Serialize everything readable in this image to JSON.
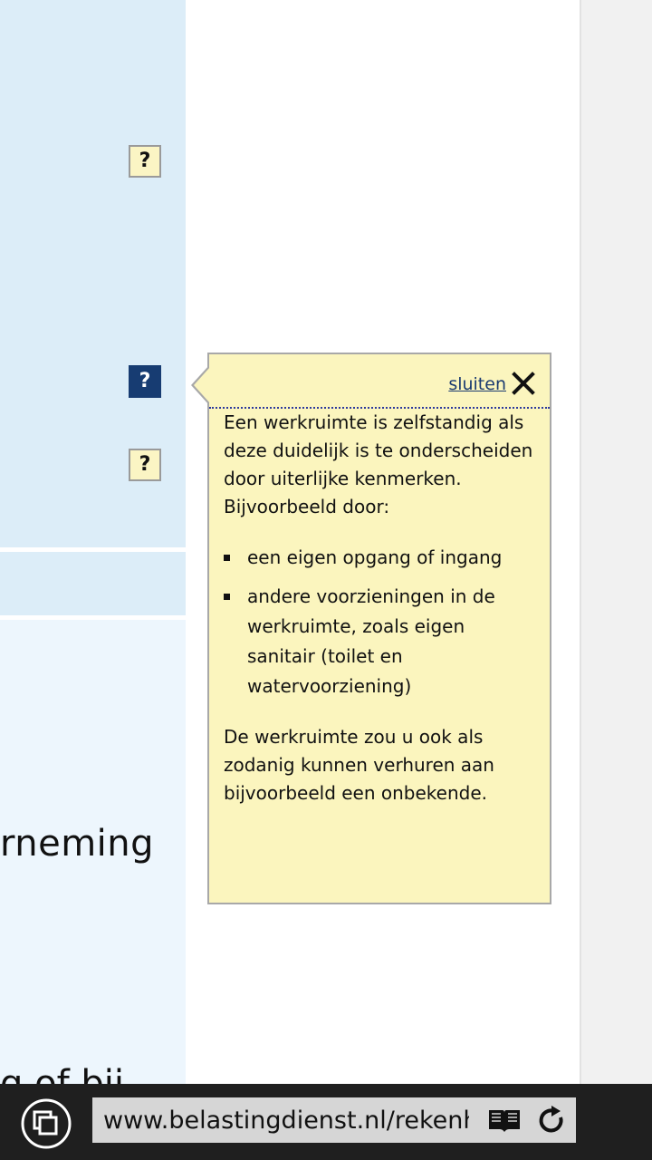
{
  "tooltip": {
    "close_label": "sluiten",
    "intro": "Een werkruimte is zelfstandig als deze duidelijk is te onderscheiden door uiterlijke kenmerken. Bijvoorbeeld door:",
    "bullets": [
      "een eigen opgang of ingang",
      "andere voorzieningen in de werkruimte, zoals eigen sanitair (toilet en watervoorziening)"
    ],
    "outro": "De werkruimte zou u ook als zodanig kunnen verhuren aan bijvoorbeeld een onbekende."
  },
  "help_buttons": [
    "?",
    "?",
    "?"
  ],
  "background_text": {
    "partial_word": "rneming",
    "partial_bottom": "g of bij"
  },
  "browser": {
    "url": "www.belastingdienst.nl/rekenhu"
  },
  "colors": {
    "panel_blue": "#dcedf8",
    "tooltip_yellow": "#fbf5be",
    "active_help": "#173c72"
  }
}
